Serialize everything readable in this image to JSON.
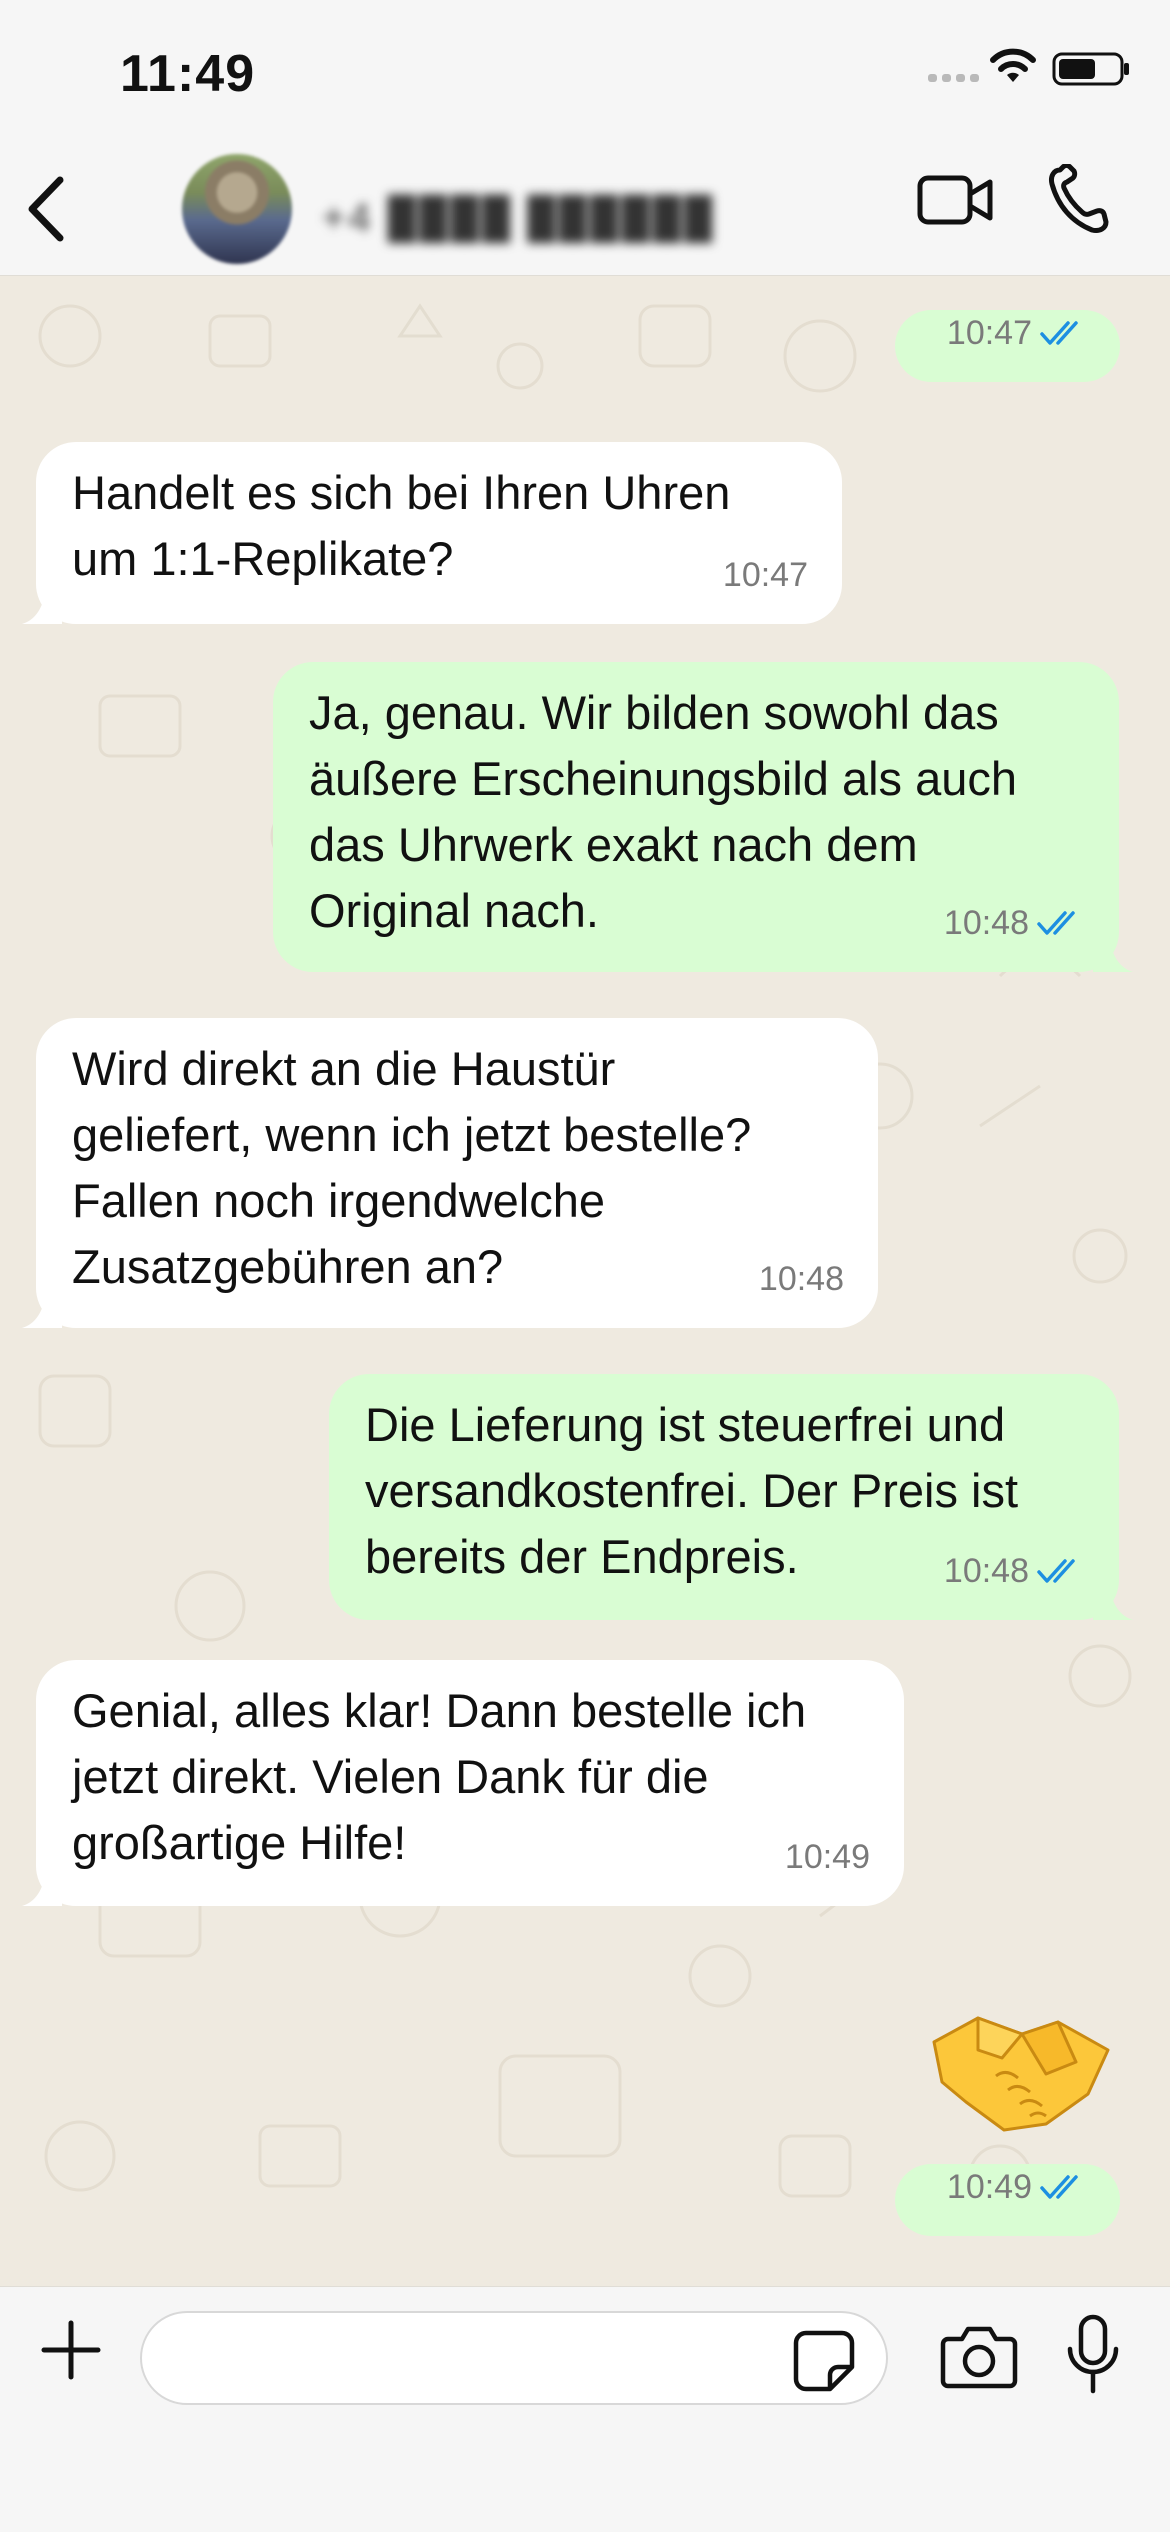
{
  "status_bar": {
    "time": "11:49"
  },
  "header": {
    "contact_name": "+4 ████ ██████",
    "icons": [
      "chevron-left-icon",
      "video-call-icon",
      "phone-call-icon"
    ]
  },
  "messages": [
    {
      "direction": "out",
      "text": "",
      "time": "10:47",
      "status": "read"
    },
    {
      "direction": "in",
      "text": "Handelt es sich bei Ihren Uhren\num 1:1-Replikate?",
      "time": "10:47"
    },
    {
      "direction": "out",
      "text": "Ja, genau. Wir bilden sowohl das\näußere Erscheinungsbild als auch\ndas Uhrwerk exakt nach dem\nOriginal nach.",
      "time": "10:48",
      "status": "read"
    },
    {
      "direction": "in",
      "text": "Wird direkt an die Haustür\ngeliefert, wenn ich jetzt bestelle?\nFallen noch irgendwelche\nZusatzgebühren an?",
      "time": "10:48"
    },
    {
      "direction": "out",
      "text": "Die Lieferung ist steuerfrei und\nversandkostenfrei. Der Preis ist\nbereits der Endpreis.",
      "time": "10:48",
      "status": "read"
    },
    {
      "direction": "in",
      "text": "Genial, alles klar! Dann bestelle ich\njetzt direkt. Vielen Dank für die\ngroßartige Hilfe!",
      "time": "10:49"
    },
    {
      "direction": "out",
      "text": "🤝",
      "type": "emoji",
      "emoji_name": "handshake-emoji",
      "time": "10:49",
      "status": "read"
    }
  ],
  "input_bar": {
    "placeholder": "",
    "value": "",
    "icons": [
      "plus-icon",
      "sticker-icon",
      "camera-icon",
      "microphone-icon"
    ]
  },
  "colors": {
    "incoming_bubble": "#ffffff",
    "outgoing_bubble": "#d9fdd3",
    "read_ticks": "#1d8fe1",
    "chat_background": "#efeae0"
  }
}
